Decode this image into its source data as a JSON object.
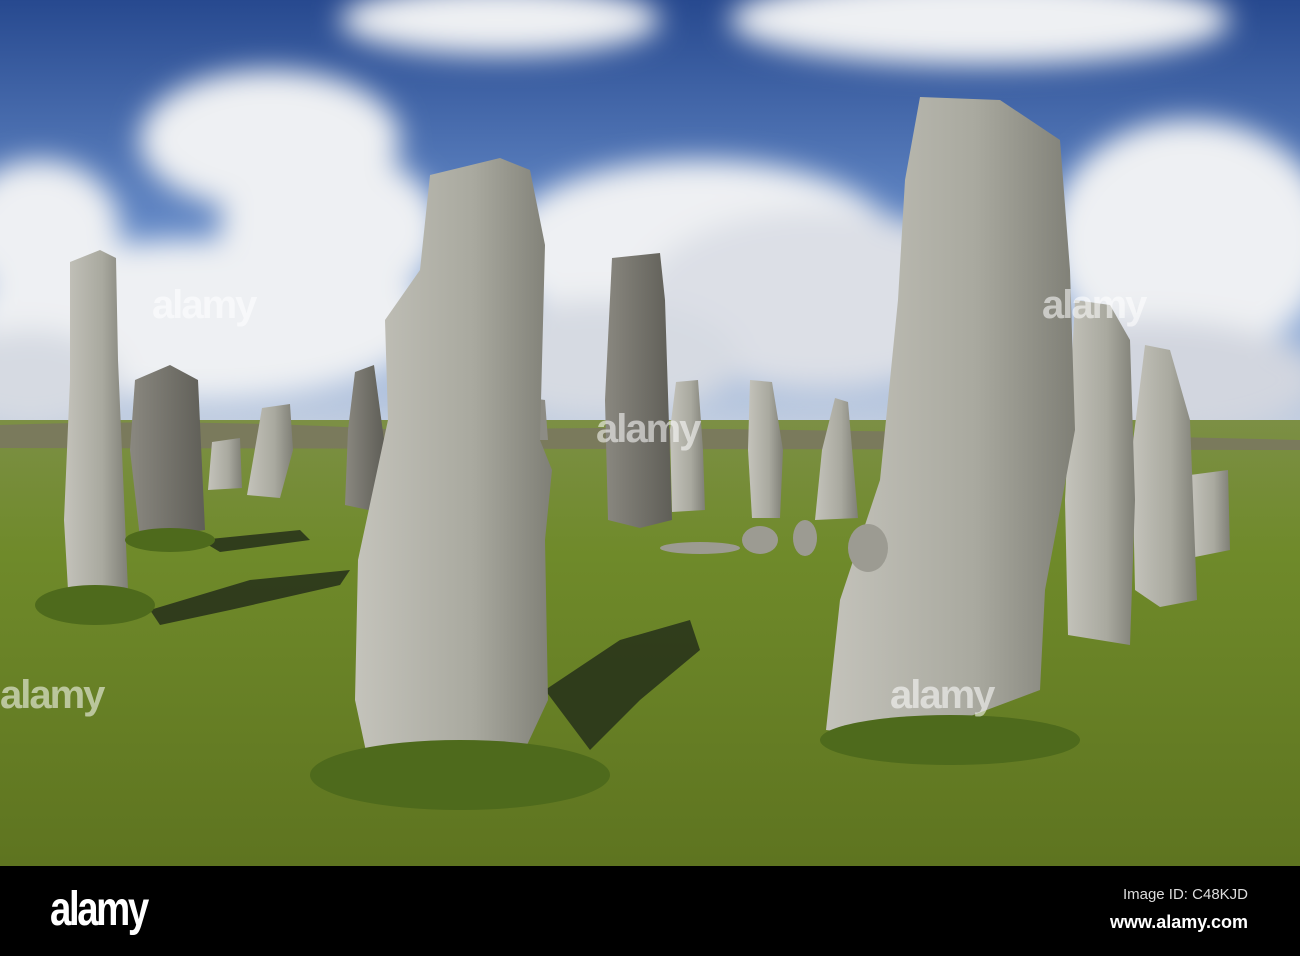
{
  "photo": {
    "subject": "Standing stones in grassland under cloudy blue sky",
    "colors": {
      "sky_top": "#2a4f9a",
      "sky_low": "#7fa2d6",
      "cloud": "#f2f3f5",
      "grass": "#6f8a2a",
      "stone": "#a9a99f",
      "shadow": "#1d2410"
    }
  },
  "watermark": "alamy",
  "footer": {
    "logo": "alamy",
    "image_id": "Image ID: C48KJD",
    "website": "www.alamy.com"
  }
}
